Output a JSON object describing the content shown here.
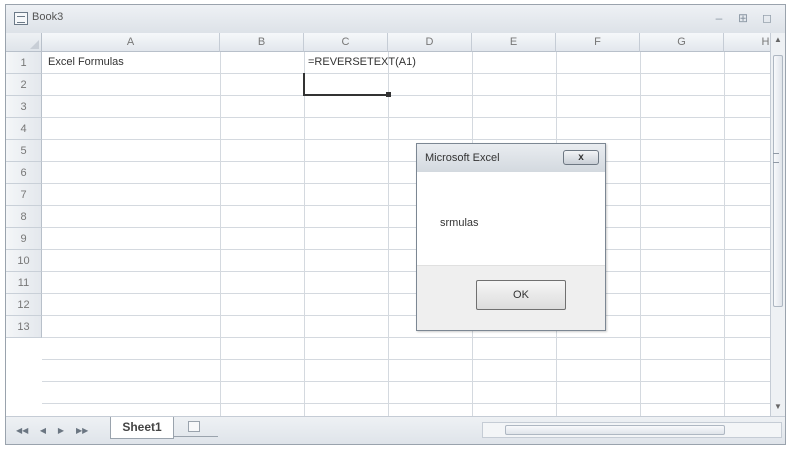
{
  "window": {
    "title": "Book3",
    "minimize_glyph": "–",
    "restore_glyph": "⊞",
    "close_glyph": "◻"
  },
  "columns": [
    "A",
    "B",
    "C",
    "D",
    "E",
    "F",
    "G",
    "H"
  ],
  "rows": [
    "1",
    "2",
    "3",
    "4",
    "5",
    "6",
    "7",
    "8",
    "9",
    "10",
    "11",
    "12",
    "13"
  ],
  "cells": {
    "A1": "Excel Formulas",
    "C1": "=REVERSETEXT(A1)"
  },
  "sheet_tabs": [
    "Sheet1"
  ],
  "nav_buttons": [
    "◀◀",
    "◀",
    "▶",
    "▶▶"
  ],
  "dialog": {
    "title": "Microsoft Excel",
    "close_label": "x",
    "message": "srmulas",
    "ok_label": "OK"
  }
}
